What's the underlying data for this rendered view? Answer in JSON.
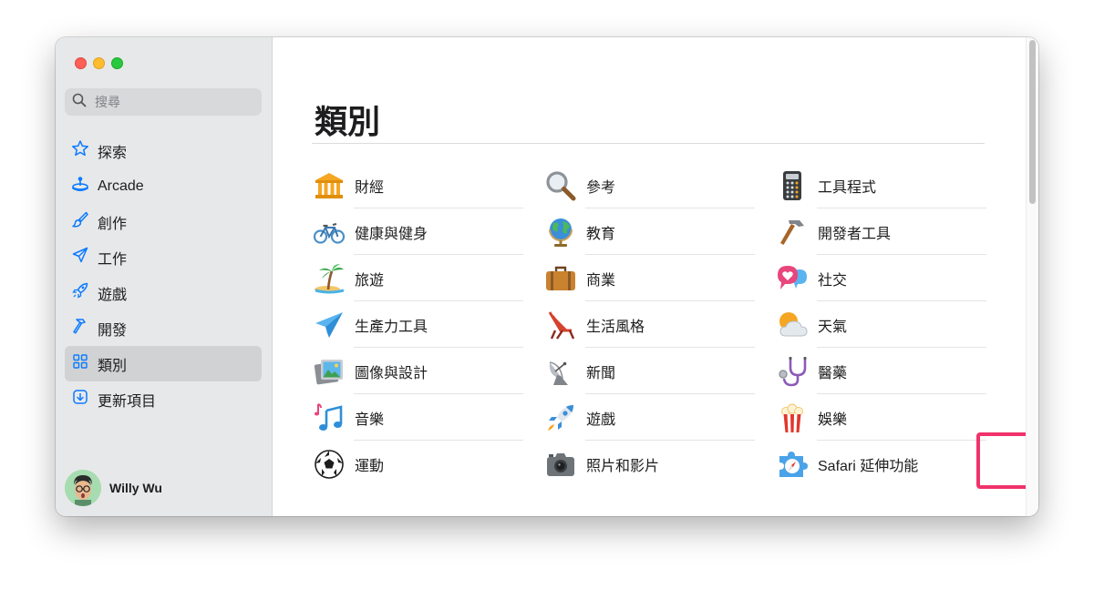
{
  "search": {
    "placeholder": "搜尋",
    "icon": "search-icon"
  },
  "sidebar": {
    "items": [
      {
        "label": "探索",
        "icon": "star-icon",
        "active": false
      },
      {
        "label": "Arcade",
        "icon": "joystick-icon",
        "active": false
      },
      {
        "label": "創作",
        "icon": "paintbrush-icon",
        "active": false
      },
      {
        "label": "工作",
        "icon": "paperplane-icon",
        "active": false
      },
      {
        "label": "遊戲",
        "icon": "rocket-icon",
        "active": false
      },
      {
        "label": "開發",
        "icon": "hammer-icon",
        "active": false
      },
      {
        "label": "類別",
        "icon": "grid-icon",
        "active": true
      },
      {
        "label": "更新項目",
        "icon": "download-icon",
        "active": false
      }
    ],
    "accent_color": "#0a7aff"
  },
  "user": {
    "name": "Willy Wu"
  },
  "main": {
    "title": "類別",
    "columns": [
      [
        {
          "label": "財經",
          "icon": "bank-icon"
        },
        {
          "label": "健康與健身",
          "icon": "bicycle-icon"
        },
        {
          "label": "旅遊",
          "icon": "palm-island-icon"
        },
        {
          "label": "生產力工具",
          "icon": "paper-plane-icon"
        },
        {
          "label": "圖像與設計",
          "icon": "picture-frame-icon"
        },
        {
          "label": "音樂",
          "icon": "music-notes-icon"
        },
        {
          "label": "運動",
          "icon": "soccer-ball-icon"
        }
      ],
      [
        {
          "label": "參考",
          "icon": "magnifier-icon"
        },
        {
          "label": "教育",
          "icon": "globe-icon"
        },
        {
          "label": "商業",
          "icon": "briefcase-icon"
        },
        {
          "label": "生活風格",
          "icon": "beach-chair-icon"
        },
        {
          "label": "新聞",
          "icon": "satellite-dish-icon"
        },
        {
          "label": "遊戲",
          "icon": "rocket-icon"
        },
        {
          "label": "照片和影片",
          "icon": "camera-icon"
        }
      ],
      [
        {
          "label": "工具程式",
          "icon": "calculator-icon"
        },
        {
          "label": "開發者工具",
          "icon": "hammer-icon"
        },
        {
          "label": "社交",
          "icon": "chat-heart-icon"
        },
        {
          "label": "天氣",
          "icon": "sun-cloud-icon"
        },
        {
          "label": "醫藥",
          "icon": "stethoscope-icon"
        },
        {
          "label": "娛樂",
          "icon": "popcorn-icon"
        },
        {
          "label": "Safari 延伸功能",
          "icon": "safari-puzzle-icon"
        }
      ]
    ],
    "highlight_color": "#f0336b"
  }
}
